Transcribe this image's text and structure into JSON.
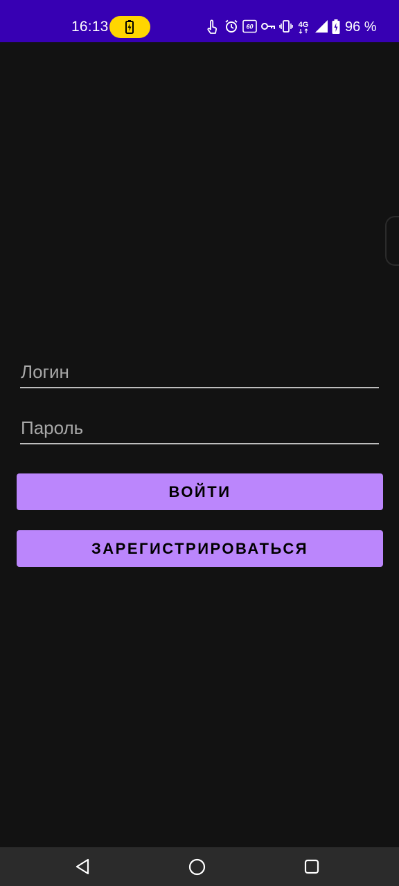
{
  "status_bar": {
    "time": "16:13",
    "battery_percent": "96 %",
    "background_color": "#3700B3",
    "icons": [
      "battery-charging-icon",
      "touch-icon",
      "alarm-icon",
      "refresh-rate-60-icon",
      "vpn-key-icon",
      "vibrate-icon",
      "network-4g-icon",
      "signal-icon",
      "battery-icon"
    ],
    "refresh_rate_label": "60",
    "network_label": "4G"
  },
  "form": {
    "login_placeholder": "Логин",
    "password_placeholder": "Пароль",
    "login_value": "",
    "password_value": ""
  },
  "buttons": {
    "login_label": "ВОЙТИ",
    "register_label": "ЗАРЕГИСТРИРОВАТЬСЯ",
    "color": "#BB86FC"
  },
  "nav_bar": {
    "icons": [
      "back-icon",
      "home-icon",
      "recents-icon"
    ]
  },
  "colors": {
    "background": "#121212",
    "accent": "#BB86FC",
    "status_bar": "#3700B3"
  }
}
